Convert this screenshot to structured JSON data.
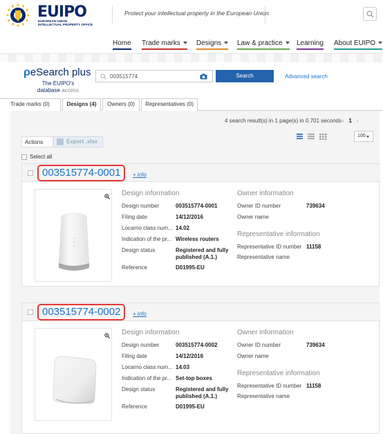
{
  "header": {
    "logo_text": "EUIPO",
    "logo_sub_1": "EUROPEAN UNION",
    "logo_sub_2": "INTELLECTUAL PROPERTY OFFICE",
    "tagline": "Protect your intellectual property in the European Union"
  },
  "nav": {
    "items": [
      {
        "label": "Home"
      },
      {
        "label": "Trade marks"
      },
      {
        "label": "Designs"
      },
      {
        "label": "Law & practice"
      },
      {
        "label": "Learning"
      },
      {
        "label": "About EUIPO"
      }
    ]
  },
  "esearch": {
    "title_prefix": "ρ",
    "title": "eSearch plus",
    "subtitle_1": "The EUIPO's",
    "subtitle_2a": "database ",
    "subtitle_2b": "access",
    "search_value": "003515774",
    "search_button": "Search",
    "advanced_link": "Advanced search"
  },
  "tabs": [
    {
      "label": "Trade marks (0)"
    },
    {
      "label": "Designs (4)"
    },
    {
      "label": "Owners (0)"
    },
    {
      "label": "Representatives (0)"
    }
  ],
  "results": {
    "count_text": "4 search result(s) in 1 page(s) in 0.701 seconds",
    "page_prev": "‹",
    "page_current": "1",
    "page_next": "›",
    "per_page": "100",
    "actions_label": "Actions",
    "export_label": "Export .xlsx",
    "select_all": "Select all"
  },
  "labels": {
    "design_info": "Design information",
    "design_number": "Design number",
    "filing_date": "Filing date",
    "locarno": "Locarno class num...",
    "indication": "Indication of the pr...",
    "status": "Design status",
    "reference": "Reference",
    "owner_info": "Owner information",
    "owner_id": "Owner ID number",
    "owner_name": "Owner name",
    "rep_info": "Representative information",
    "rep_id": "Representative ID number",
    "rep_name": "Representative name",
    "info_link": "+ info"
  },
  "cards": [
    {
      "number": "003515774-0001",
      "design_number": "003515774-0001",
      "filing_date": "14/12/2016",
      "locarno": "14.02",
      "indication": "Wireless routers",
      "status_1": "Registered and fully",
      "status_2": "published (A.1.)",
      "reference": "D01995-EU",
      "owner_id": "739634",
      "rep_id": "11158"
    },
    {
      "number": "003515774-0002",
      "design_number": "003515774-0002",
      "filing_date": "14/12/2016",
      "locarno": "14.03",
      "indication": "Set-top boxes",
      "status_1": "Registered and fully",
      "status_2": "published (A.1.)",
      "reference": "D01995-EU",
      "owner_id": "739634",
      "rep_id": "11158"
    }
  ],
  "colors": {
    "brand_navy": "#0a2a68",
    "link_blue": "#1a73c9",
    "button_blue": "#2463ae",
    "highlight_red": "#e53935"
  }
}
